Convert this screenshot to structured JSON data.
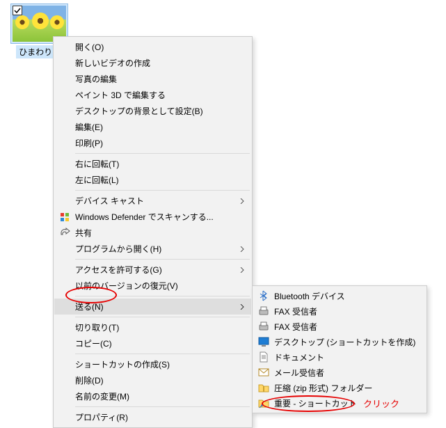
{
  "file": {
    "name": "ひまわり.jp"
  },
  "menu": {
    "open": "開く(O)",
    "new_video": "新しいビデオの作成",
    "edit_photos": "写真の編集",
    "paint3d": "ペイント 3D で編集する",
    "set_wallpaper": "デスクトップの背景として設定(B)",
    "edit": "編集(E)",
    "print": "印刷(P)",
    "rotate_right": "右に回転(T)",
    "rotate_left": "左に回転(L)",
    "device_cast": "デバイス キャスト",
    "defender_scan": "Windows Defender でスキャンする...",
    "share": "共有",
    "open_with": "プログラムから開く(H)",
    "grant_access": "アクセスを許可する(G)",
    "restore_versions": "以前のバージョンの復元(V)",
    "send_to": "送る(N)",
    "cut": "切り取り(T)",
    "copy": "コピー(C)",
    "create_shortcut": "ショートカットの作成(S)",
    "delete": "削除(D)",
    "rename": "名前の変更(M)",
    "properties": "プロパティ(R)"
  },
  "submenu": {
    "bluetooth": "Bluetooth デバイス",
    "fax1": "FAX 受信者",
    "fax2": "FAX 受信者",
    "desktop_shortcut": "デスクトップ (ショートカットを作成)",
    "documents": "ドキュメント",
    "mail": "メール受信者",
    "zip": "圧縮 (zip 形式) フォルダー",
    "important": "重要 - ショートカット"
  },
  "annotation": {
    "click_label": "クリック"
  }
}
